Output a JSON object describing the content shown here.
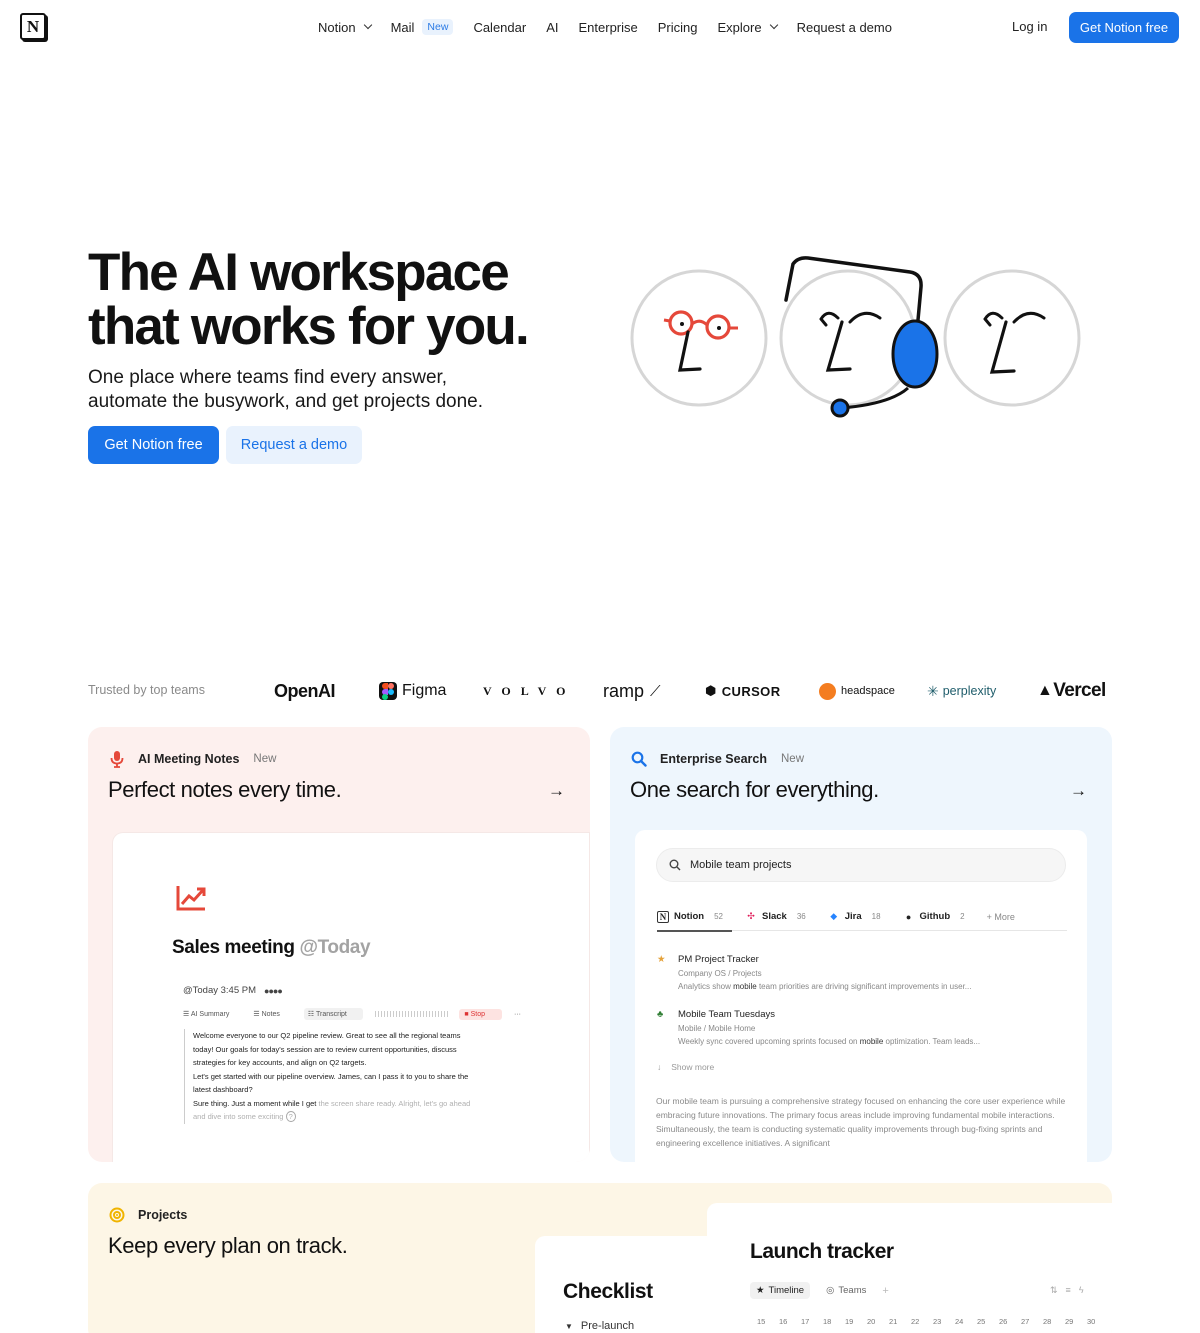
{
  "nav": {
    "logo_letter": "N",
    "items": [
      {
        "label": "Notion",
        "dropdown": true
      },
      {
        "label": "Mail",
        "badge": "New"
      },
      {
        "label": "Calendar"
      },
      {
        "label": "AI"
      },
      {
        "label": "Enterprise"
      },
      {
        "label": "Pricing"
      },
      {
        "label": "Explore",
        "dropdown": true
      },
      {
        "label": "Request a demo"
      }
    ],
    "login": "Log in",
    "cta": "Get Notion free"
  },
  "hero": {
    "title_line1": "The AI workspace",
    "title_line2": "that works for you.",
    "subtitle_line1": "One place where teams find every answer,",
    "subtitle_line2": "automate the busywork, and get projects done.",
    "primary": "Get Notion free",
    "secondary": "Request a demo"
  },
  "trusted": {
    "label": "Trusted by top teams",
    "brands": {
      "openai": "OpenAI",
      "figma": "Figma",
      "volvo": "VOLVO",
      "ramp": "ramp",
      "cursor": "CURSOR",
      "headspace": "headspace",
      "perplexity": "perplexity",
      "vercel": "Vercel"
    }
  },
  "cards": {
    "notes": {
      "tag": "AI Meeting Notes",
      "badge": "New",
      "title": "Perfect notes every time.",
      "meeting_title": "Sales meeting",
      "meeting_mention": "@Today",
      "meta": "@Today 3:45 PM",
      "tabs": [
        "AI Summary",
        "Notes",
        "Transcript"
      ],
      "stop": "Stop",
      "transcript": [
        "Welcome everyone to our Q2 pipeline review. Great to see all the regional teams",
        "today! Our goals for today's session are to review current opportunities, discuss",
        "strategies for key accounts, and align on Q2 targets.",
        "Let's get started with our pipeline overview. James, can I pass it to you to share the",
        "latest dashboard?"
      ],
      "transcript_last": "Sure thing. Just a moment while I get",
      "transcript_faded1": " the screen share ready. Alright, let's go ahead",
      "transcript_faded2": "and dive into some exciting"
    },
    "search": {
      "tag": "Enterprise Search",
      "badge": "New",
      "title": "One search for everything.",
      "query": "Mobile team projects",
      "sources": [
        {
          "name": "Notion",
          "count": "52"
        },
        {
          "name": "Slack",
          "count": "36"
        },
        {
          "name": "Jira",
          "count": "18"
        },
        {
          "name": "Github",
          "count": "2"
        }
      ],
      "more": "+ More",
      "results": [
        {
          "title": "PM Project Tracker",
          "path": "Company OS / Projects",
          "snippet_a": "Analytics show ",
          "snippet_b": "mobile",
          "snippet_c": " team priorities are driving significant improvements in user..."
        },
        {
          "title": "Mobile Team Tuesdays",
          "path": "Mobile / Mobile Home",
          "snippet_a": "Weekly sync covered upcoming sprints focused on ",
          "snippet_b": "mobile",
          "snippet_c": " optimization. Team leads..."
        }
      ],
      "show_more": "Show more",
      "summary": "Our mobile team is pursuing a comprehensive strategy focused on enhancing the core user experience while embracing future innovations. The primary focus areas include improving fundamental mobile interactions. Simultaneously, the team is conducting systematic quality improvements through bug-fixing sprints and engineering excellence initiatives. A significant"
    },
    "projects": {
      "tag": "Projects",
      "title": "Keep every plan on track.",
      "checklist_title": "Checklist",
      "checklist_item": "Pre-launch",
      "launch_title": "Launch tracker",
      "chips": [
        "Timeline",
        "Teams"
      ],
      "days": [
        "15",
        "16",
        "17",
        "18",
        "19",
        "20",
        "21",
        "22",
        "23",
        "24",
        "25",
        "26",
        "27",
        "28",
        "29",
        "30"
      ]
    }
  },
  "colors": {
    "accent": "#1a73e8",
    "accent_soft": "#e9f2fd",
    "notes_bg": "#fdf0ee",
    "search_bg": "#eef6fd",
    "projects_bg": "#fdf6e6",
    "notes_icon": "#e5483a",
    "search_icon": "#1a73e8",
    "projects_icon": "#f0b400"
  },
  "icons": {
    "notes": "microphone-icon",
    "search": "magnifier-icon",
    "projects": "target-icon",
    "chart": "trend-chart-icon"
  }
}
